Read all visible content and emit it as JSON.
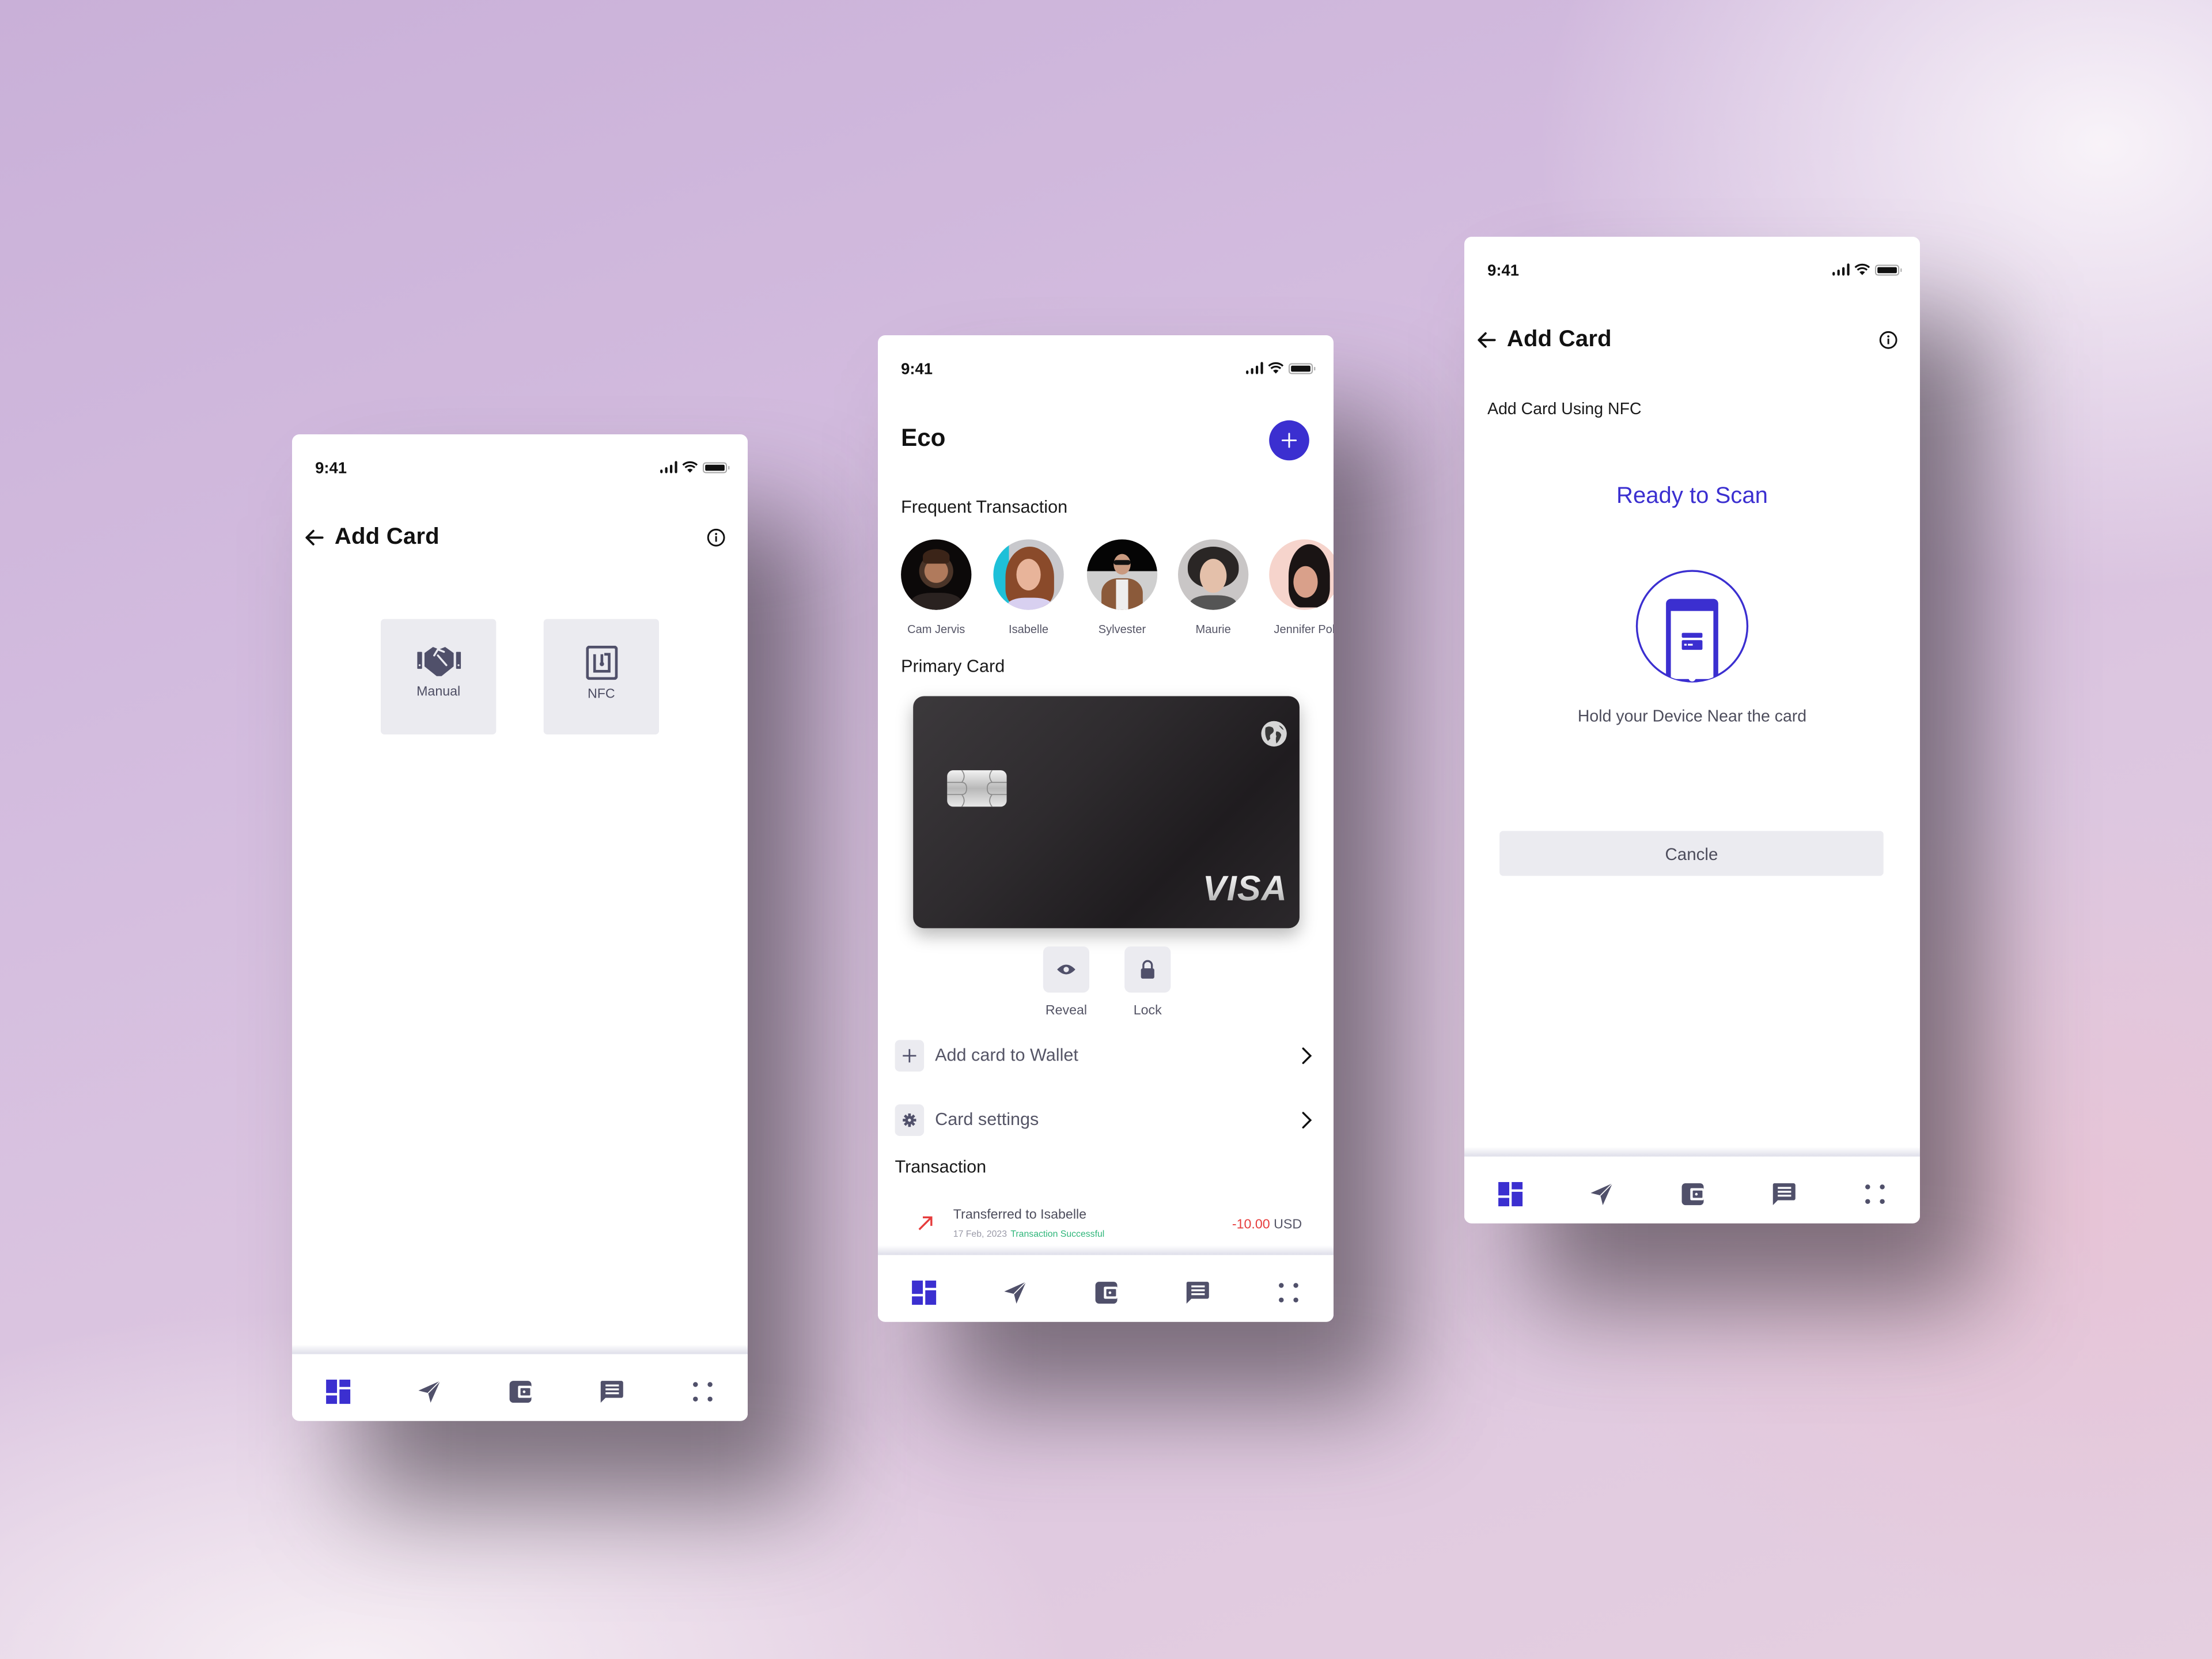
{
  "colors": {
    "accent": "#3b2fd0",
    "icon_gray": "#50506a",
    "tile_bg": "#ebebf0",
    "negative": "#e63c3c",
    "success": "#2fb67a"
  },
  "status_bar": {
    "time": "9:41"
  },
  "bottom_nav": {
    "items": [
      {
        "icon": "dashboard-icon",
        "label": "Dashboard",
        "active": true
      },
      {
        "icon": "send-icon",
        "label": "Send",
        "active": false
      },
      {
        "icon": "wallet-icon",
        "label": "Wallet",
        "active": false
      },
      {
        "icon": "chat-icon",
        "label": "Messages",
        "active": false
      },
      {
        "icon": "more-icon",
        "label": "More",
        "active": false
      }
    ]
  },
  "screen_add_card": {
    "title": "Add Card",
    "back_icon": "arrow-left-icon",
    "info_icon": "info-icon",
    "methods": [
      {
        "icon": "handshake-icon",
        "label": "Manual"
      },
      {
        "icon": "nfc-icon",
        "label": "NFC"
      }
    ]
  },
  "screen_home": {
    "title": "Eco",
    "add_button_icon": "plus-icon",
    "frequent_label": "Frequent Transaction",
    "contacts": [
      {
        "name": "Cam Jervis"
      },
      {
        "name": "Isabelle"
      },
      {
        "name": "Sylvester"
      },
      {
        "name": "Maurie"
      },
      {
        "name": "Jennifer Pol"
      }
    ],
    "primary_card_label": "Primary Card",
    "card": {
      "brand": "VISA"
    },
    "card_actions": [
      {
        "icon": "eye-icon",
        "label": "Reveal"
      },
      {
        "icon": "lock-icon",
        "label": "Lock"
      }
    ],
    "menu": [
      {
        "icon": "plus-icon",
        "label": "Add card to Wallet"
      },
      {
        "icon": "gear-icon",
        "label": "Card settings"
      }
    ],
    "transaction_label": "Transaction",
    "transactions": [
      {
        "title": "Transferred to Isabelle",
        "date": "17 Feb, 2023",
        "status": "Transaction Successful",
        "amount": "-10.00",
        "currency": "USD"
      }
    ]
  },
  "screen_nfc": {
    "title": "Add Card",
    "subtitle": "Add Card Using NFC",
    "status": "Ready to Scan",
    "instruction": "Hold your Device Near the card",
    "cancel_label": "Cancle"
  }
}
